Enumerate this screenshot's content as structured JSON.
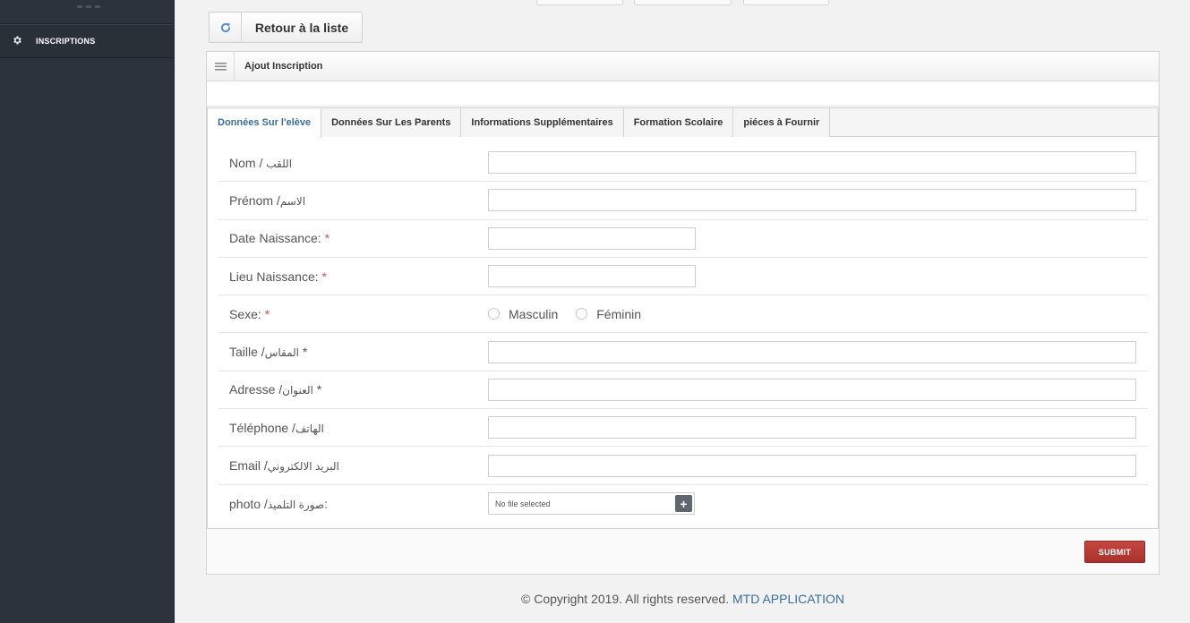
{
  "sidebar": {
    "items": [
      {
        "label": "INSCRIPTIONS",
        "icon": "gear-icon"
      }
    ]
  },
  "toolbar": {
    "back_label": "Retour à la liste",
    "back_icon": "refresh-icon"
  },
  "panel": {
    "title": "Ajout Inscription",
    "tabs": [
      {
        "label": "Données Sur l'elève",
        "active": true
      },
      {
        "label": "Données Sur Les Parents",
        "active": false
      },
      {
        "label": "Informations Supplémentaires",
        "active": false
      },
      {
        "label": "Formation Scolaire",
        "active": false
      },
      {
        "label": "piéces à Fournir",
        "active": false
      }
    ]
  },
  "form": {
    "nom": {
      "label": "Nom / ",
      "ar": "اللقب"
    },
    "prenom": {
      "label": "Prénom /",
      "ar": "الاسم"
    },
    "date_naissance": {
      "label": "Date Naissance: ",
      "req": "*"
    },
    "lieu_naissance": {
      "label": "Lieu Naissance: ",
      "req": "*"
    },
    "sexe": {
      "label": "Sexe: ",
      "req": "*",
      "options": [
        "Masculin",
        "Féminin"
      ]
    },
    "taille": {
      "label": "Taille /",
      "ar": "المقاس",
      "req": " *"
    },
    "adresse": {
      "label": "Adresse /",
      "ar": "العنوان",
      "req": " *"
    },
    "telephone": {
      "label": "Téléphone /",
      "ar": "الهاتف"
    },
    "email": {
      "label": "Email /",
      "ar": "البريد الالكتروني"
    },
    "photo": {
      "label": "photo /",
      "ar": "صورة التلميذ",
      "suffix": ":",
      "file_value": "No file selected"
    }
  },
  "actions": {
    "submit_label": "SUBMIT"
  },
  "footer": {
    "copyright": "© Copyright 2019. All rights reserved. ",
    "brand": "MTD APPLICATION"
  },
  "colors": {
    "sidebar_bg": "#2c333c",
    "accent": "#3a6d9a",
    "submit": "#b33a35",
    "required": "#d9534f"
  }
}
